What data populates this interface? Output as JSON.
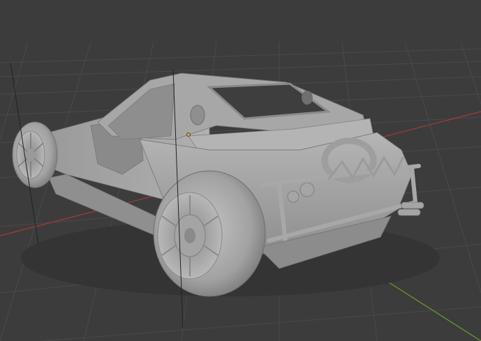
{
  "viewport": {
    "background": "#3c3c3c",
    "grid_color": "#4a4a4a",
    "x_axis_color": "#a83a3a",
    "y_axis_color": "#6a9a2a"
  },
  "scene": {
    "object": "sports-car-mesh",
    "shading": "solid",
    "mesh_color": "#a3a3a3",
    "shadow_color": "#6e6e6e",
    "origin_marker_color": "#e8a33a"
  }
}
